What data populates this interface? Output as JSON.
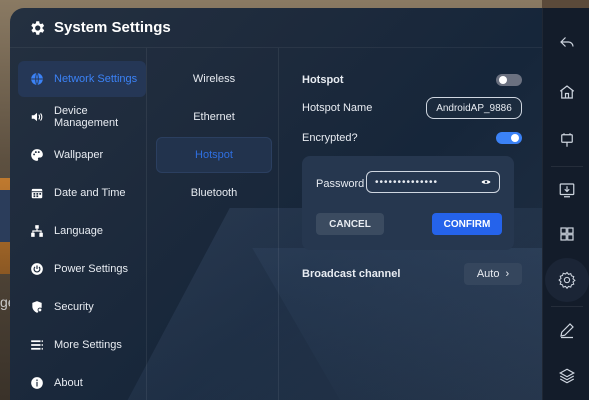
{
  "window": {
    "title": "System Settings"
  },
  "menu": [
    {
      "label": "Network Settings",
      "icon": "globe-icon",
      "active": true
    },
    {
      "label": "Device Management",
      "icon": "speaker-icon",
      "active": false
    },
    {
      "label": "Wallpaper",
      "icon": "palette-icon",
      "active": false
    },
    {
      "label": "Date and Time",
      "icon": "calendar-icon",
      "active": false
    },
    {
      "label": "Language",
      "icon": "language-icon",
      "active": false
    },
    {
      "label": "Power Settings",
      "icon": "power-icon",
      "active": false
    },
    {
      "label": "Security",
      "icon": "security-icon",
      "active": false
    },
    {
      "label": "More Settings",
      "icon": "list-icon",
      "active": false
    },
    {
      "label": "About",
      "icon": "info-icon",
      "active": false
    }
  ],
  "submenu": [
    {
      "label": "Wireless",
      "active": false
    },
    {
      "label": "Ethernet",
      "active": false
    },
    {
      "label": "Hotspot",
      "active": true
    },
    {
      "label": "Bluetooth",
      "active": false
    }
  ],
  "hotspot": {
    "heading": "Hotspot",
    "enabled": false,
    "name_label": "Hotspot Name",
    "name_value": "AndroidAP_9886",
    "encrypted_label": "Encrypted?",
    "encrypted": true,
    "password_label": "Password",
    "password_value": "••••••••••••••",
    "cancel_label": "CANCEL",
    "confirm_label": "CONFIRM",
    "broadcast_label": "Broadcast channel",
    "broadcast_value": "Auto",
    "chevron": "›"
  },
  "background": {
    "partial_text": "ger"
  },
  "rail": [
    "back-icon",
    "home-icon",
    "monitor-icon",
    "download-screen-icon",
    "apps-grid-icon",
    "settings-icon",
    "pen-icon",
    "layers-icon"
  ],
  "colors": {
    "accent": "#3b82f6",
    "confirm": "#2563eb",
    "panel": "#26374f"
  }
}
